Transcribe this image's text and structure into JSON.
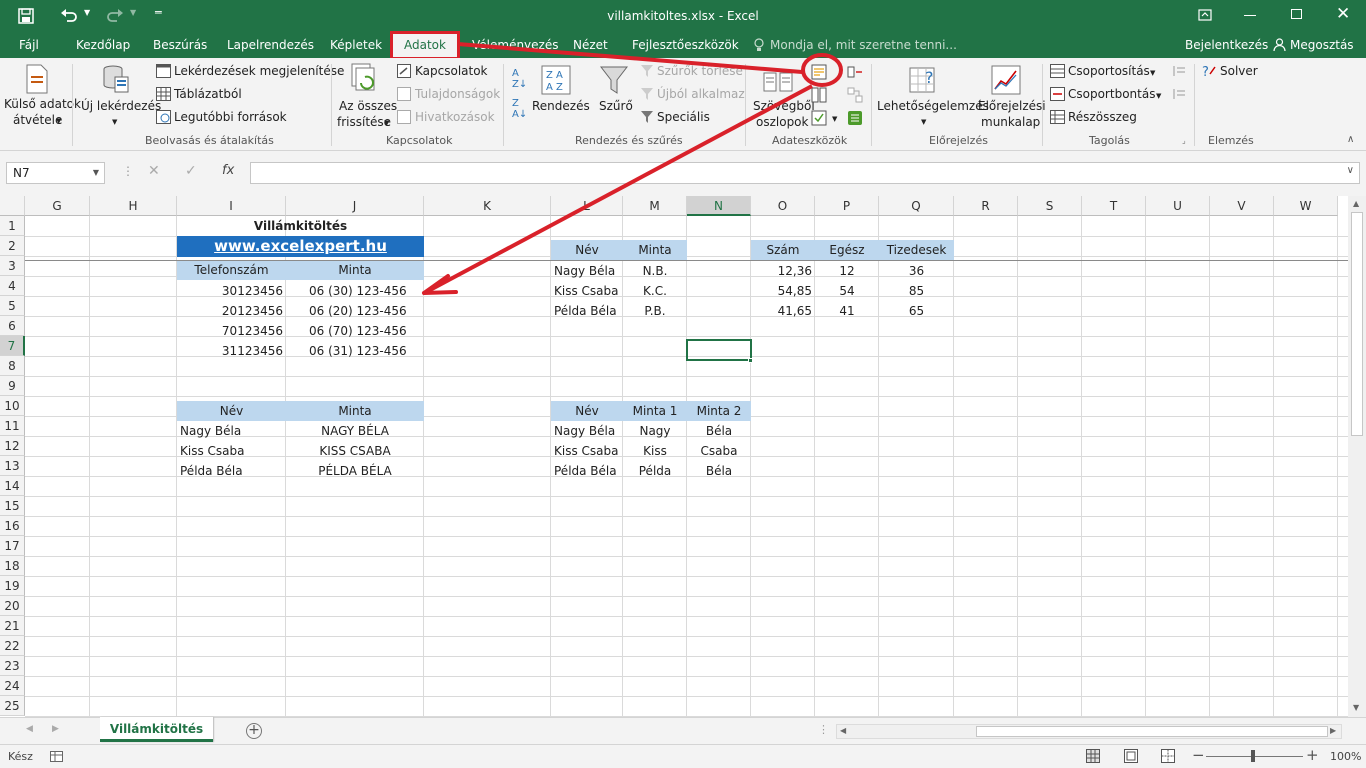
{
  "window": {
    "title": "villamkitoltes.xlsx - Excel",
    "sign_in": "Bejelentkezés",
    "share": "Megosztás"
  },
  "tabs": [
    {
      "label": "Fájl"
    },
    {
      "label": "Kezdőlap"
    },
    {
      "label": "Beszúrás"
    },
    {
      "label": "Lapelrendezés"
    },
    {
      "label": "Képletek"
    },
    {
      "label": "Adatok"
    },
    {
      "label": "Véleményezés"
    },
    {
      "label": "Nézet"
    },
    {
      "label": "Fejlesztőeszközök"
    }
  ],
  "tell_me": "Mondja el, mit szeretne tenni...",
  "ribbon": {
    "ext_data_1": "Külső adatok",
    "ext_data_2": "átvétele",
    "new_query": "Új lekérdezés",
    "show_queries": "Lekérdezések megjelenítése",
    "from_table": "Táblázatból",
    "recent_sources": "Legutóbbi források",
    "group_fetch": "Beolvasás és átalakítás",
    "refresh_all_1": "Az összes",
    "refresh_all_2": "frissítése",
    "connections": "Kapcsolatok",
    "properties": "Tulajdonságok",
    "edit_links": "Hivatkozások",
    "group_connections": "Kapcsolatok",
    "sort": "Rendezés",
    "filter": "Szűrő",
    "clear_filters": "Szűrők törlése",
    "reapply": "Újból alkalmaz",
    "advanced": "Speciális",
    "group_sort_filter": "Rendezés és szűrés",
    "text_to_columns_1": "Szövegből",
    "text_to_columns_2": "oszlopok",
    "group_data_tools": "Adateszközök",
    "what_if": "Lehetőségelemzés",
    "forecast_1": "Előrejelzési",
    "forecast_2": "munkalap",
    "group_forecast": "Előrejelzés",
    "group_rows": "Csoportosítás",
    "ungroup": "Csoportbontás",
    "subtotal": "Részösszeg",
    "group_outline": "Tagolás",
    "solver": "Solver",
    "group_analysis": "Elemzés"
  },
  "formula": {
    "name_box": "N7",
    "fx": "fx"
  },
  "columns": [
    "G",
    "H",
    "I",
    "J",
    "K",
    "L",
    "M",
    "N",
    "O",
    "P",
    "Q",
    "R",
    "S",
    "T",
    "U",
    "V",
    "W"
  ],
  "rows": [
    "1",
    "2",
    "3",
    "4",
    "5",
    "6",
    "7",
    "8",
    "9",
    "10",
    "11",
    "12",
    "13",
    "14",
    "15",
    "16",
    "17",
    "18",
    "19",
    "20",
    "21",
    "22",
    "23",
    "24",
    "25"
  ],
  "sheet": {
    "title": "Villámkitöltés",
    "link": "www.excelexpert.hu",
    "phone_header": "Telefonszám",
    "pattern_header": "Minta",
    "phones": [
      {
        "num": "30123456",
        "fmt": "06 (30) 123-456"
      },
      {
        "num": "20123456",
        "fmt": "06 (20) 123-456"
      },
      {
        "num": "70123456",
        "fmt": "06 (70) 123-456"
      },
      {
        "num": "31123456",
        "fmt": "06 (31) 123-456"
      }
    ],
    "upper_name_header": "Név",
    "upper_pattern_header": "Minta",
    "upper": [
      {
        "name": "Nagy Béla",
        "up": "NAGY BÉLA"
      },
      {
        "name": "Kiss Csaba",
        "up": "KISS CSABA"
      },
      {
        "name": "Példa Béla",
        "up": "PÉLDA BÉLA"
      }
    ],
    "init_name_header": "Név",
    "init_pattern_header": "Minta",
    "initials": [
      {
        "name": "Nagy Béla",
        "init": "N.B."
      },
      {
        "name": "Kiss Csaba",
        "init": "K.C."
      },
      {
        "name": "Példa Béla",
        "init": "P.B."
      }
    ],
    "split_name_header": "Név",
    "split_p1_header": "Minta 1",
    "split_p2_header": "Minta 2",
    "split": [
      {
        "name": "Nagy Béla",
        "p1": "Nagy",
        "p2": "Béla"
      },
      {
        "name": "Kiss Csaba",
        "p1": "Kiss",
        "p2": "Csaba"
      },
      {
        "name": "Példa Béla",
        "p1": "Példa",
        "p2": "Béla"
      }
    ],
    "num_header": "Szám",
    "int_header": "Egész",
    "dec_header": "Tizedesek",
    "nums": [
      {
        "n": "12,36",
        "i": "12",
        "d": "36"
      },
      {
        "n": "54,85",
        "i": "54",
        "d": "85"
      },
      {
        "n": "41,65",
        "i": "41",
        "d": "65"
      }
    ]
  },
  "sheet_tab": "Villámkitöltés",
  "status": {
    "ready": "Kész",
    "zoom": "100%"
  },
  "colors": {
    "excel_green": "#217346",
    "header_blue": "#bdd7ee",
    "link_blue": "#1f6fbf",
    "annotation_red": "#d9212a"
  }
}
